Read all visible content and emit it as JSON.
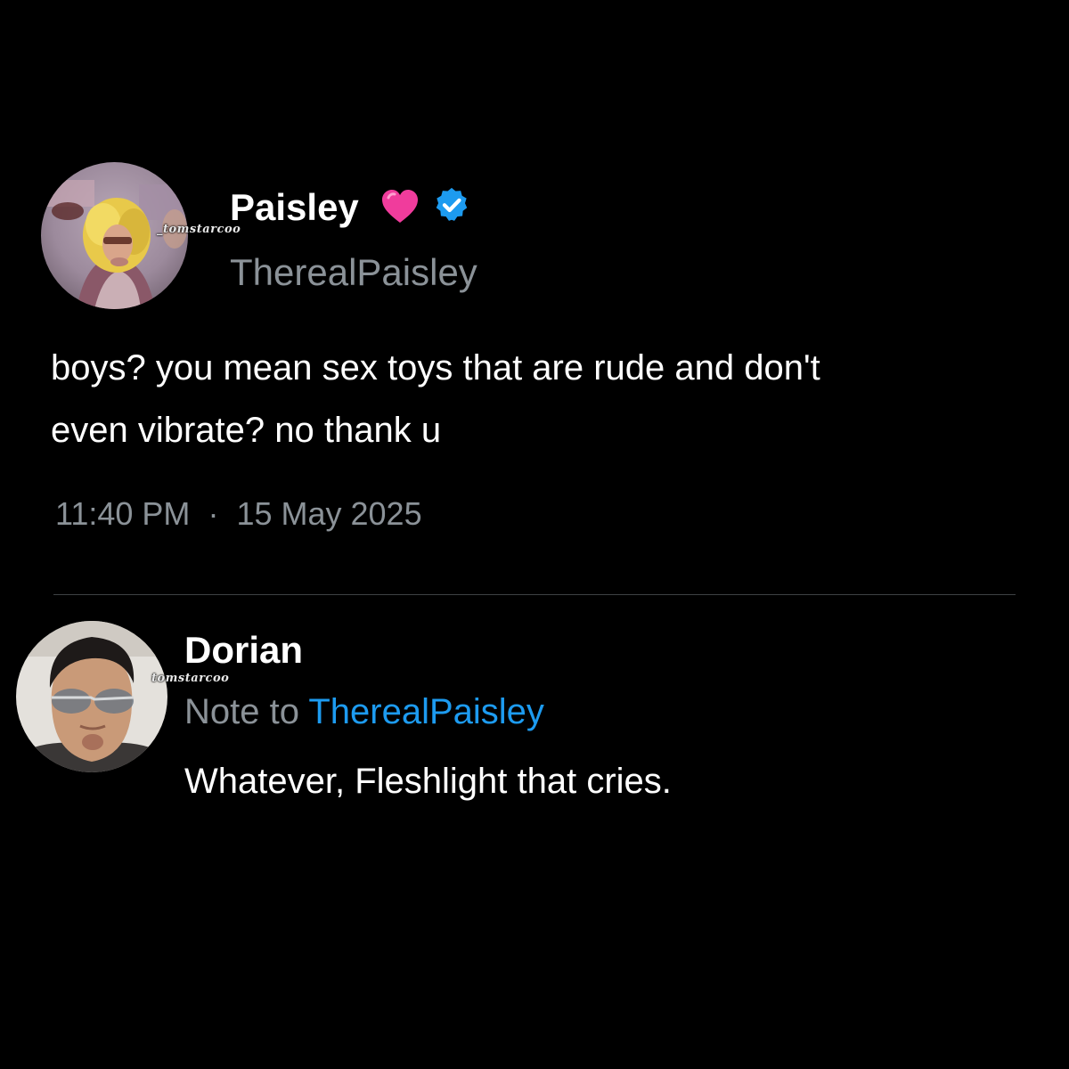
{
  "post": {
    "author": {
      "display_name": "Paisley",
      "handle": "TherealPaisley",
      "emoji": "💗",
      "verified": true,
      "watermark": "_tomstarcoo"
    },
    "text_line_1": "boys? you mean sex toys that are rude and don't",
    "text_line_2": "even vibrate? no thank u",
    "time": "11:40 PM",
    "separator": "·",
    "date": "15 May 2025",
    "icons": {
      "emoji_icon": "pink-heart-icon",
      "verified_icon": "verified-badge-icon"
    }
  },
  "reply": {
    "author": {
      "display_name": "Dorian",
      "watermark": "tomstarcoo"
    },
    "note_prefix": "Note to",
    "note_handle": "TherealPaisley",
    "text": "Whatever, Fleshlight that cries."
  },
  "colors": {
    "background": "#000000",
    "primary_text": "#ffffff",
    "secondary_text": "#8b9298",
    "link": "#1d9bf0",
    "verified": "#1d9bf0",
    "heart": "#f03c9c",
    "divider": "#3e4144"
  }
}
